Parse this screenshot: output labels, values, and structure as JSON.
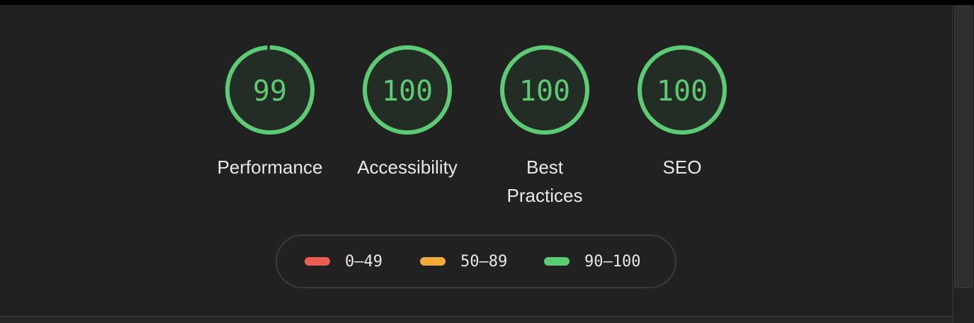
{
  "colors": {
    "background": "#212121",
    "pass": "#5ccc74",
    "pass_fill": "#232c25",
    "average": "#f4a93b",
    "fail": "#ec5d51",
    "text": "#e8e8e8"
  },
  "gauges": [
    {
      "score": "99",
      "value": 99,
      "label": "Performance"
    },
    {
      "score": "100",
      "value": 100,
      "label": "Accessibility"
    },
    {
      "score": "100",
      "value": 100,
      "label": "Best Practices"
    },
    {
      "score": "100",
      "value": 100,
      "label": "SEO"
    }
  ],
  "legend": {
    "items": [
      {
        "label": "0–49",
        "color": "#ec5d51"
      },
      {
        "label": "50–89",
        "color": "#f4a93b"
      },
      {
        "label": "90–100",
        "color": "#5ccc74"
      }
    ]
  }
}
